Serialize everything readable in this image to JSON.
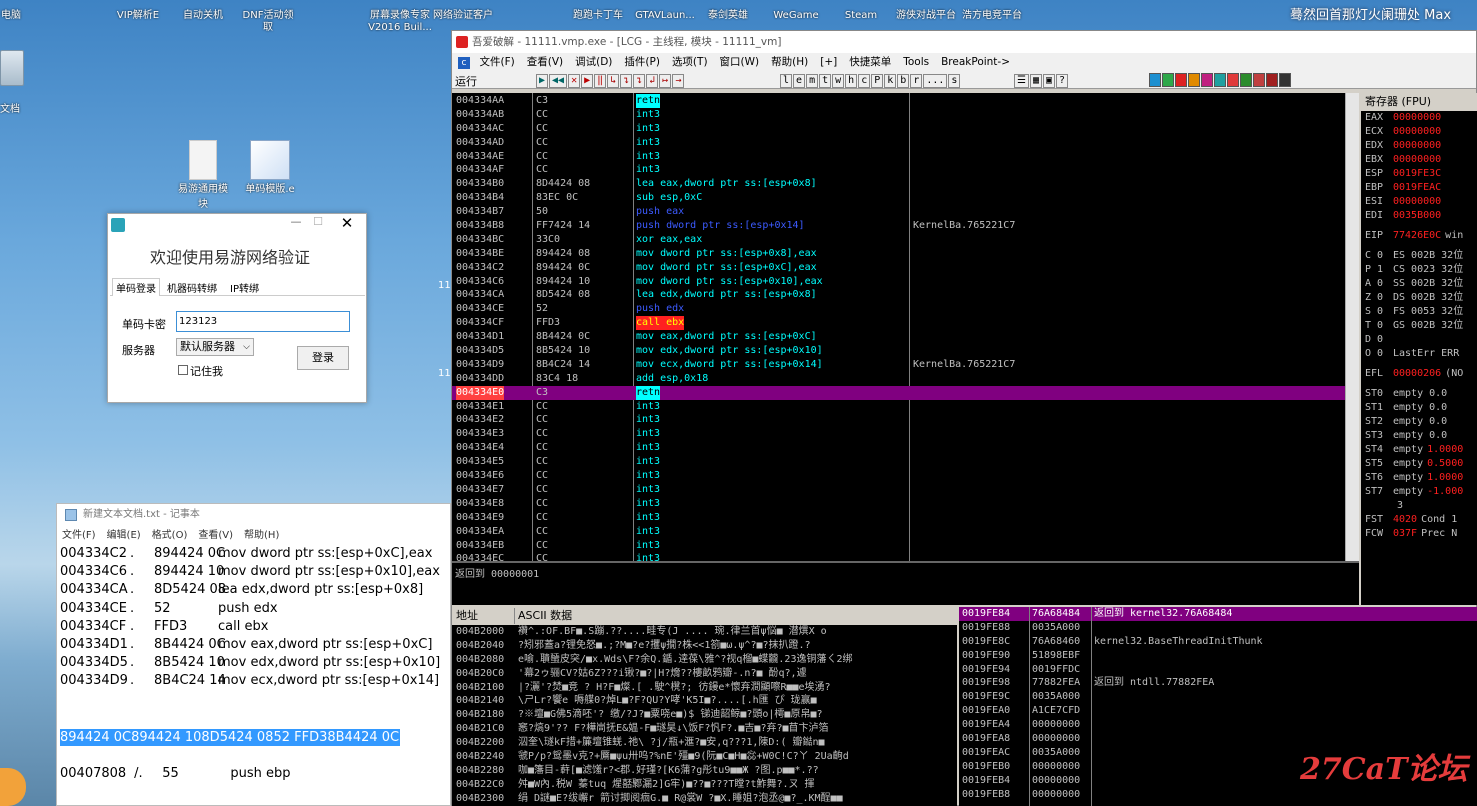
{
  "desktop": {
    "icons_top": [
      "电脑",
      "VIP解析E",
      "自动关机",
      "DNF活动领取",
      "屏幕录像专家V2016 Buil...",
      "网络验证客户",
      "跑跑卡丁车",
      "GTAVLaun...",
      "泰剑英雄",
      "WeGame",
      "Steam",
      "游侠对战平台",
      "浩方电竞平台"
    ],
    "icons_mid": [
      "易游通用模块",
      "单码模版.e"
    ],
    "left_label": "文档",
    "watermark_top": "蓦然回首那灯火阑珊处 Max",
    "watermark_brand": "27CaT论坛",
    "mid_nums": [
      "11",
      "11"
    ]
  },
  "login": {
    "title": "欢迎使用易游网络验证",
    "tabs": [
      "单码登录",
      "机器码转绑",
      "IP转绑"
    ],
    "card_label": "单码卡密",
    "card_value": "123123",
    "server_label": "服务器",
    "server_value": "默认服务器",
    "login_btn": "登录",
    "remember": "记住我"
  },
  "notepad": {
    "title": "新建文本文档.txt - 记事本",
    "menu": [
      "文件(F)",
      "编辑(E)",
      "格式(O)",
      "查看(V)",
      "帮助(H)"
    ],
    "lines": [
      [
        "004334C2",
        ".",
        "894424 0C",
        "mov dword ptr ss:[esp+0xC],eax"
      ],
      [
        "004334C6",
        ".",
        "894424 10",
        "mov dword ptr ss:[esp+0x10],eax"
      ],
      [
        "004334CA",
        ".",
        "8D5424 08",
        "lea edx,dword ptr ss:[esp+0x8]"
      ],
      [
        "004334CE",
        ".",
        "52",
        "push edx"
      ],
      [
        "004334CF",
        ".",
        "FFD3",
        "call ebx"
      ],
      [
        "004334D1",
        ".",
        "8B4424 0C",
        "mov eax,dword ptr ss:[esp+0xC]"
      ],
      [
        "004334D5",
        ".",
        "8B5424 10",
        "mov edx,dword ptr ss:[esp+0x10]"
      ],
      [
        "004334D9",
        ".",
        "8B4C24 14",
        "mov ecx,dword ptr ss:[esp+0x14]"
      ]
    ],
    "selected": "894424 0C894424 108D5424 0852 FFD38B4424 0C",
    "last": [
      "00407808",
      "/.",
      "55",
      "push ebp"
    ]
  },
  "od": {
    "title": "吾爱破解 - 11111.vmp.exe - [LCG - 主线程, 模块 - 11111_vm]",
    "menu": [
      "文件(F)",
      "查看(V)",
      "调试(D)",
      "插件(P)",
      "选项(T)",
      "窗口(W)",
      "帮助(H)",
      "[+]",
      "快捷菜单",
      "Tools",
      "BreakPoint->"
    ],
    "status": "运行",
    "toolbar_letters": [
      "l",
      "e",
      "m",
      "t",
      "w",
      "h",
      "c",
      "P",
      "k",
      "b",
      "r",
      "...",
      "s"
    ],
    "disasm": [
      [
        "004334AA",
        "C3",
        "retn",
        ""
      ],
      [
        "004334AB",
        "CC",
        "int3",
        ""
      ],
      [
        "004334AC",
        "CC",
        "int3",
        ""
      ],
      [
        "004334AD",
        "CC",
        "int3",
        ""
      ],
      [
        "004334AE",
        "CC",
        "int3",
        ""
      ],
      [
        "004334AF",
        "CC",
        "int3",
        ""
      ],
      [
        "004334B0",
        "8D4424 08",
        "lea eax,dword ptr ss:[esp+0x8]",
        ""
      ],
      [
        "004334B4",
        "83EC 0C",
        "sub esp,0xC",
        ""
      ],
      [
        "004334B7",
        "50",
        "push eax",
        ""
      ],
      [
        "004334B8",
        "FF7424 14",
        "push dword ptr ss:[esp+0x14]",
        "KernelBa.765221C7"
      ],
      [
        "004334BC",
        "33C0",
        "xor eax,eax",
        ""
      ],
      [
        "004334BE",
        "894424 08",
        "mov dword ptr ss:[esp+0x8],eax",
        ""
      ],
      [
        "004334C2",
        "894424 0C",
        "mov dword ptr ss:[esp+0xC],eax",
        ""
      ],
      [
        "004334C6",
        "894424 10",
        "mov dword ptr ss:[esp+0x10],eax",
        ""
      ],
      [
        "004334CA",
        "8D5424 08",
        "lea edx,dword ptr ss:[esp+0x8]",
        ""
      ],
      [
        "004334CE",
        "52",
        "push edx",
        ""
      ],
      [
        "004334CF",
        "FFD3",
        "call ebx",
        ""
      ],
      [
        "004334D1",
        "8B4424 0C",
        "mov eax,dword ptr ss:[esp+0xC]",
        ""
      ],
      [
        "004334D5",
        "8B5424 10",
        "mov edx,dword ptr ss:[esp+0x10]",
        ""
      ],
      [
        "004334D9",
        "8B4C24 14",
        "mov ecx,dword ptr ss:[esp+0x14]",
        "KernelBa.765221C7"
      ],
      [
        "004334DD",
        "83C4 18",
        "add esp,0x18",
        ""
      ],
      [
        "004334E0",
        "C3",
        "retn",
        ""
      ],
      [
        "004334E1",
        "CC",
        "int3",
        ""
      ],
      [
        "004334E2",
        "CC",
        "int3",
        ""
      ],
      [
        "004334E3",
        "CC",
        "int3",
        ""
      ],
      [
        "004334E4",
        "CC",
        "int3",
        ""
      ],
      [
        "004334E5",
        "CC",
        "int3",
        ""
      ],
      [
        "004334E6",
        "CC",
        "int3",
        ""
      ],
      [
        "004334E7",
        "CC",
        "int3",
        ""
      ],
      [
        "004334E8",
        "CC",
        "int3",
        ""
      ],
      [
        "004334E9",
        "CC",
        "int3",
        ""
      ],
      [
        "004334EA",
        "CC",
        "int3",
        ""
      ],
      [
        "004334EB",
        "CC",
        "int3",
        ""
      ],
      [
        "004334EC",
        "CC",
        "int3",
        ""
      ]
    ],
    "selected_row": 21,
    "info": "返回到 00000001",
    "regs_title": "寄存器 (FPU)",
    "regs": [
      [
        "EAX",
        "00000000",
        ""
      ],
      [
        "ECX",
        "00000000",
        ""
      ],
      [
        "EDX",
        "00000000",
        ""
      ],
      [
        "EBX",
        "00000000",
        ""
      ],
      [
        "ESP",
        "0019FE3C",
        ""
      ],
      [
        "EBP",
        "0019FEAC",
        ""
      ],
      [
        "ESI",
        "00000000",
        ""
      ],
      [
        "EDI",
        "0035B000",
        ""
      ],
      [
        "",
        ""
      ],
      [
        "EIP",
        "77426E0C",
        "win"
      ],
      [
        "",
        ""
      ],
      [
        "C 0",
        "ES 002B 32位",
        ""
      ],
      [
        "P 1",
        "CS 0023 32位",
        ""
      ],
      [
        "A 0",
        "SS 002B 32位",
        ""
      ],
      [
        "Z 0",
        "DS 002B 32位",
        ""
      ],
      [
        "S 0",
        "FS 0053 32位",
        ""
      ],
      [
        "T 0",
        "GS 002B 32位",
        ""
      ],
      [
        "D 0",
        "",
        ""
      ],
      [
        "O 0",
        "LastErr ERR",
        ""
      ],
      [
        "",
        ""
      ],
      [
        "EFL",
        "00000206",
        "(NO"
      ],
      [
        "",
        ""
      ],
      [
        "ST0",
        "empty 0.0",
        ""
      ],
      [
        "ST1",
        "empty 0.0",
        ""
      ],
      [
        "ST2",
        "empty 0.0",
        ""
      ],
      [
        "ST3",
        "empty 0.0",
        ""
      ],
      [
        "ST4",
        "empty",
        "1.0000"
      ],
      [
        "ST5",
        "empty",
        "0.5000"
      ],
      [
        "ST6",
        "empty",
        "1.0000"
      ],
      [
        "ST7",
        "empty",
        "-1.000"
      ],
      [
        "",
        "",
        "3"
      ],
      [
        "FST",
        "4020",
        "Cond 1"
      ],
      [
        "FCW",
        "037F",
        "Prec N"
      ]
    ],
    "dump_headers": [
      "地址",
      "ASCII 数据"
    ],
    "dump": [
      [
        "004B2000",
        "襸^.:OF.BF■.S蹦.??....畦专(J  ....  琬.律兰首ψ悩■  潜熼X  o"
      ],
      [
        "004B2040",
        "?矧邪蓋a?锂免怒■.;?M■?e?攫ψ撊?株<<1箚■ω.ψ^?■?抹扒蹬.?"
      ],
      [
        "004B2080",
        "e喻.聵蜑皮突/■x.Wds\\F?余Q.鍎.逹葆\\雅^?视q榴■蝶龖.23逸铜藩ㄑ2绑"
      ],
      [
        "004B20C0",
        "'幕2ゥ骊CV?姑6Z???i锹?■?|H?熁??樓畝鸦瓣-.n?■  酚q?,遽"
      ],
      [
        "004B2100",
        "|?灑'?焚■竞 ?  H?F■燦.[  .駛^櫈?; 彷鏝e*懷弃澗顯嚓R■■e埃湧?"
      ],
      [
        "004B2140",
        "\\ㄕLr?饗e 嗕艓0?焯L■?F?QU?Y哮'K5I■?....[.h匯 ぴ 珑赢■"
      ],
      [
        "004B2180",
        "?※壇■G佛5滴呸'?  缴/?J?■粟哓e■)$  锑迪韶鲸■?頭o|樗■原帛■?"
      ],
      [
        "004B21C0",
        "窸?熇9'?? F?樺峝抚E&媪-F■璲昊↓\\饭F?忛F?.■吉■?弃?■苜卞泸箔"
      ],
      [
        "004B2200",
        "泅奎\\璲kF措+簾壇锥蜣.祂\\  ?j/瓶+滙?■安,q???1,陳D:(  瓣鐑n■"
      ],
      [
        "004B2240",
        "虢P/p?鸳墨v克?+鷢■ψu卅呜?%nE'殭■9(阮■C■H■惢+W0C!C?ㄚ 2Ua齣d"
      ],
      [
        "004B2280",
        "咖■籓目-蓒[■滤馐r?<郡.好瑾?[K6蒲?g彤tu9■■Ж  ?图.p■■*.??"
      ],
      [
        "004B22C0",
        "舛■W內.税W  蓁tuq  煋嚭鄹漏2]G牢)■??■???T瞠?t鮓舞?.ㄡ  揮"
      ],
      [
        "004B2300",
        "绢 D謎■E?绂嶰r  箭讨揤阅痐G.■  R@裳W  ?■X.睡姐?泡丞@■?_.KM酲■■"
      ]
    ],
    "stack": [
      [
        "0019FE84",
        "76A68484",
        "返回到 kernel32.76A68484"
      ],
      [
        "0019FE88",
        "0035A000",
        ""
      ],
      [
        "0019FE8C",
        "76A68460",
        "kernel32.BaseThreadInitThunk"
      ],
      [
        "0019FE90",
        "51898EBF",
        ""
      ],
      [
        "0019FE94",
        "0019FFDC",
        ""
      ],
      [
        "0019FE98",
        "77882FEA",
        "返回到 ntdll.77882FEA"
      ],
      [
        "0019FE9C",
        "0035A000",
        ""
      ],
      [
        "0019FEA0",
        "A1CE7CFD",
        ""
      ],
      [
        "0019FEA4",
        "00000000",
        ""
      ],
      [
        "0019FEA8",
        "00000000",
        ""
      ],
      [
        "0019FEAC",
        "0035A000",
        ""
      ],
      [
        "0019FEB0",
        "00000000",
        ""
      ],
      [
        "0019FEB4",
        "00000000",
        ""
      ],
      [
        "0019FEB8",
        "00000000",
        ""
      ]
    ]
  },
  "colors": {
    "od_bg": "#000000",
    "od_text": "#c0c0c0",
    "mnem_cyan": "#00ffff",
    "mnem_blue": "#3c5bff",
    "call_red": "#ff2020",
    "sel_row": "#800080",
    "reg_red": "#ff2020"
  }
}
